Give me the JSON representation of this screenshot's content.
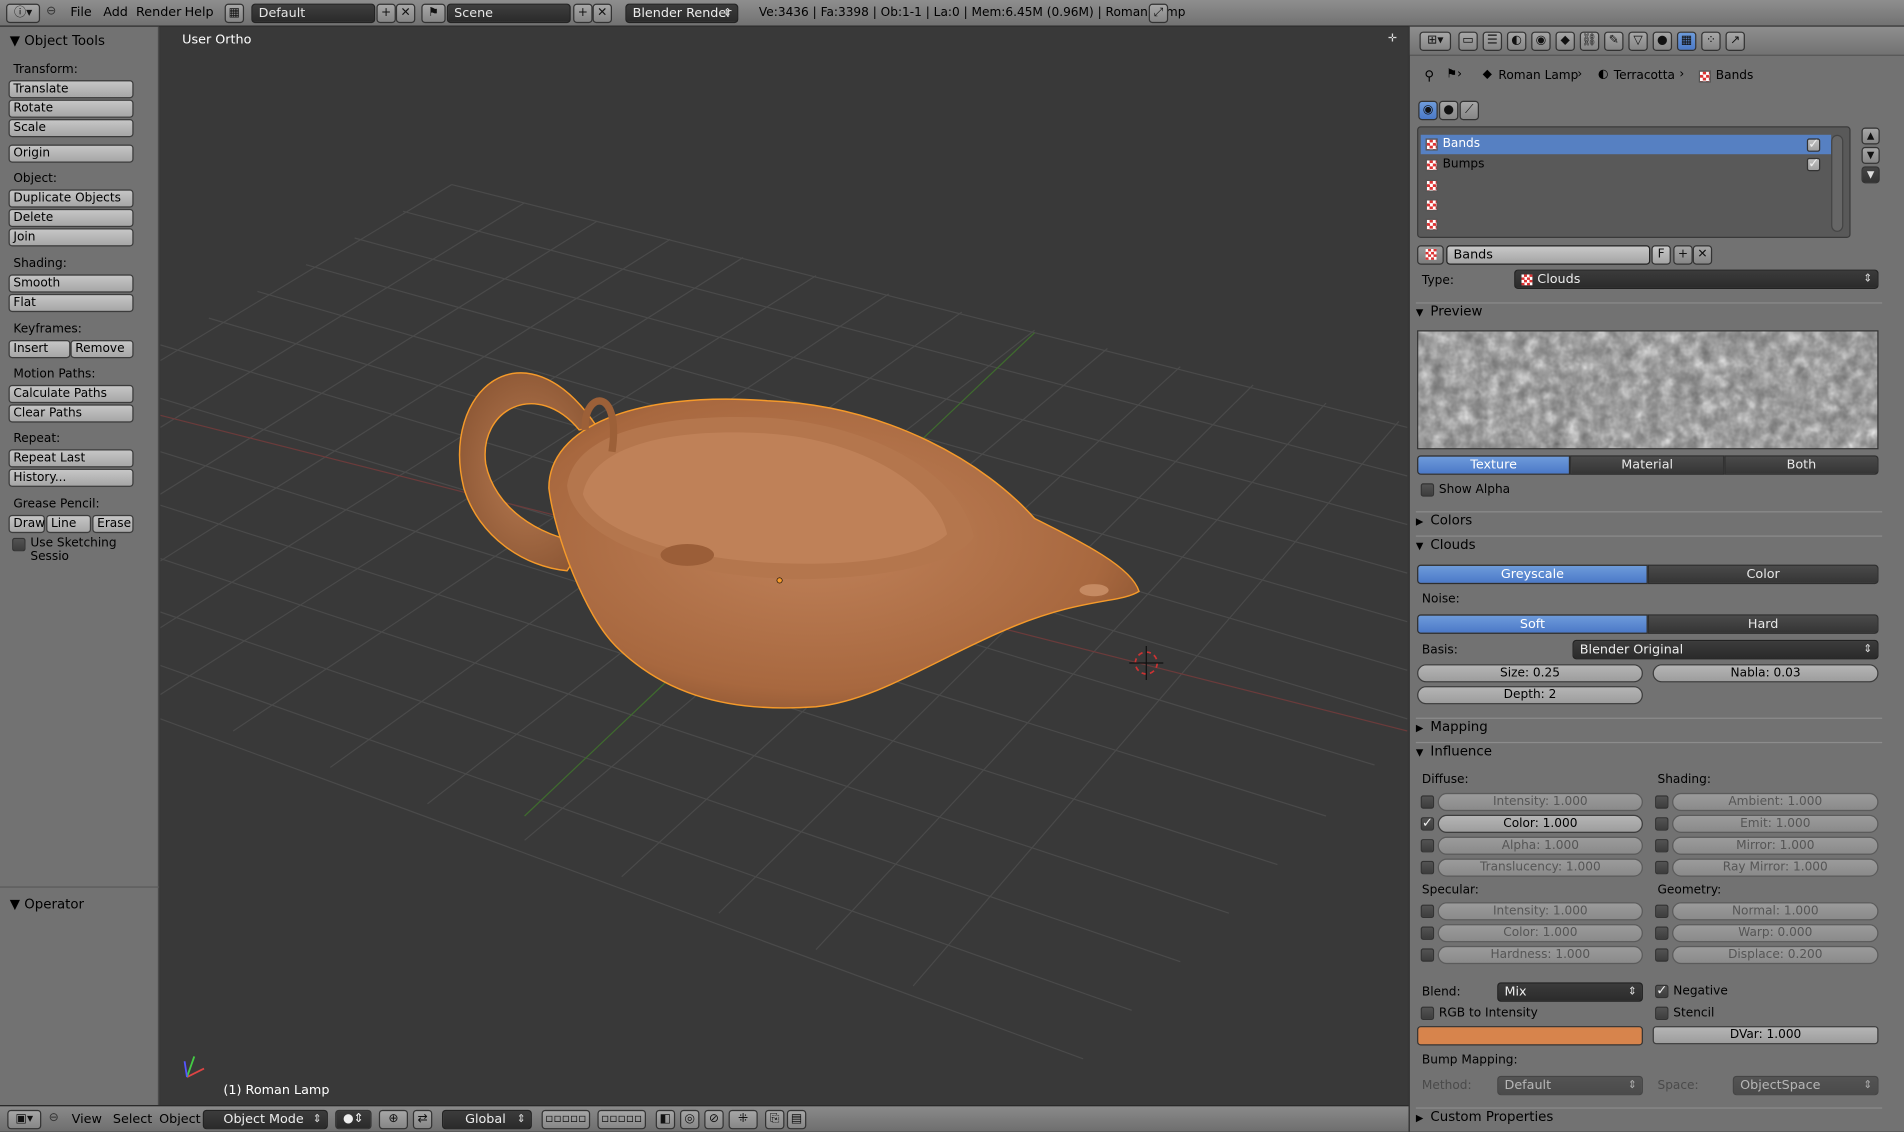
{
  "header": {
    "menus": [
      "File",
      "Add",
      "Render",
      "Help"
    ],
    "screen_layout": "Default",
    "scene": "Scene",
    "engine": "Blender Render",
    "stats": "Ve:3436 | Fa:3398 | Ob:1-1 | La:0 | Mem:6.45M (0.96M) | Roman Lamp"
  },
  "tools": {
    "title": "Object Tools",
    "transform_label": "Transform:",
    "translate": "Translate",
    "rotate": "Rotate",
    "scale": "Scale",
    "origin": "Origin",
    "object_label": "Object:",
    "duplicate": "Duplicate Objects",
    "delete": "Delete",
    "join": "Join",
    "shading_label": "Shading:",
    "smooth": "Smooth",
    "flat": "Flat",
    "keyframes_label": "Keyframes:",
    "insert": "Insert",
    "remove": "Remove",
    "motion_label": "Motion Paths:",
    "calc_paths": "Calculate Paths",
    "clear_paths": "Clear Paths",
    "repeat_label": "Repeat:",
    "repeat_last": "Repeat Last",
    "history": "History...",
    "grease_label": "Grease Pencil:",
    "draw": "Draw",
    "line": "Line",
    "erase": "Erase",
    "sketching": "Use Sketching Sessio",
    "operator": "Operator"
  },
  "viewport": {
    "view_name": "User Ortho",
    "object_label": "(1) Roman Lamp"
  },
  "footer": {
    "menus": [
      "View",
      "Select",
      "Object"
    ],
    "mode": "Object Mode",
    "orientation": "Global"
  },
  "props": {
    "breadcrumb": [
      "Roman Lamp",
      "Terracotta",
      "Bands"
    ],
    "texture_slots": [
      {
        "name": "Bands",
        "enabled": true,
        "selected": true
      },
      {
        "name": "Bumps",
        "enabled": true,
        "selected": false
      },
      {
        "name": "",
        "enabled": false,
        "selected": false
      },
      {
        "name": "",
        "enabled": false,
        "selected": false
      },
      {
        "name": "",
        "enabled": false,
        "selected": false
      }
    ],
    "texture_name": "Bands",
    "fake_user": "F",
    "type_label": "Type:",
    "type_value": "Clouds",
    "preview_header": "Preview",
    "preview_tabs": [
      "Texture",
      "Material",
      "Both"
    ],
    "show_alpha": "Show Alpha",
    "colors_header": "Colors",
    "clouds_header": "Clouds",
    "clouds_tabs": [
      "Greyscale",
      "Color"
    ],
    "noise_label": "Noise:",
    "noise_tabs": [
      "Soft",
      "Hard"
    ],
    "basis_label": "Basis:",
    "basis_value": "Blender Original",
    "size": "Size: 0.25",
    "nabla": "Nabla: 0.03",
    "depth": "Depth: 2",
    "mapping_header": "Mapping",
    "influence_header": "Influence",
    "diffuse_label": "Diffuse:",
    "shading_label": "Shading:",
    "diffuse": [
      {
        "label": "Intensity: 1.000",
        "on": false
      },
      {
        "label": "Color: 1.000",
        "on": true
      },
      {
        "label": "Alpha: 1.000",
        "on": false
      },
      {
        "label": "Translucency: 1.000",
        "on": false
      }
    ],
    "shading": [
      {
        "label": "Ambient: 1.000",
        "on": false
      },
      {
        "label": "Emit: 1.000",
        "on": false
      },
      {
        "label": "Mirror: 1.000",
        "on": false
      },
      {
        "label": "Ray Mirror: 1.000",
        "on": false
      }
    ],
    "specular_label": "Specular:",
    "geometry_label": "Geometry:",
    "specular": [
      {
        "label": "Intensity: 1.000",
        "on": false
      },
      {
        "label": "Color: 1.000",
        "on": false
      },
      {
        "label": "Hardness: 1.000",
        "on": false
      }
    ],
    "geometry": [
      {
        "label": "Normal: 1.000",
        "on": false
      },
      {
        "label": "Warp: 0.000",
        "on": false
      },
      {
        "label": "Displace: 0.200",
        "on": false
      }
    ],
    "blend_label": "Blend:",
    "blend_value": "Mix",
    "negative": "Negative",
    "rgb_to_intensity": "RGB to Intensity",
    "stencil": "Stencil",
    "dvar": "DVar: 1.000",
    "blend_color": "#d7844c",
    "bump_label": "Bump Mapping:",
    "method_label": "Method:",
    "method_value": "Default",
    "space_label": "Space:",
    "space_value": "ObjectSpace",
    "custom_props_header": "Custom Properties"
  },
  "colors": {
    "selection_blue": "#5680c2",
    "lamp_terracotta": "#b06f47",
    "outline_orange": "#f59a2a"
  }
}
